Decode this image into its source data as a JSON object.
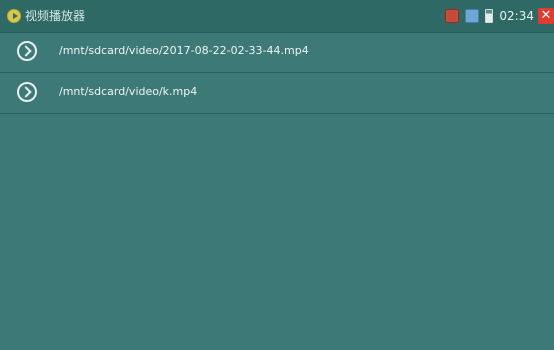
{
  "titlebar": {
    "app_title": "视频播放器",
    "clock": "02:34",
    "close_glyph": "✕",
    "icons": [
      "recording-icon",
      "network-icon",
      "battery-icon"
    ]
  },
  "files": [
    {
      "icon": "play-arrow-icon",
      "path": "/mnt/sdcard/video/2017-08-22-02-33-44.mp4"
    },
    {
      "icon": "play-arrow-icon",
      "path": "/mnt/sdcard/video/k.mp4"
    }
  ],
  "colors": {
    "background": "#3d7a77",
    "titlebar": "#2e6966",
    "close": "#e23a2e"
  }
}
